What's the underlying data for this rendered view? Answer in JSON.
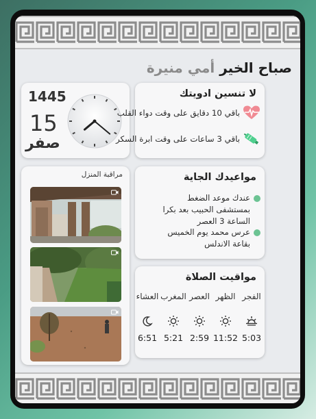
{
  "greeting": {
    "text": "صباح الخير",
    "name": "أمي منيرة"
  },
  "clock": {
    "hijri_year": "1445",
    "hijri_day": "15",
    "hijri_month": "صفر",
    "hour_hand_deg": 230,
    "minute_hand_deg": 130
  },
  "meds": {
    "title": "لا تنسين ادويتك",
    "items": [
      {
        "text": "باقي 10 دقايق على وقت دواء القلب",
        "icon": "heart-pulse-icon"
      },
      {
        "text": "باقي 3 ساعات على وقت ابرة السكر",
        "icon": "insulin-pen-icon"
      }
    ]
  },
  "cameras": {
    "title": "مراقبة المنزل",
    "feeds": [
      "front-porch",
      "backyard-lawn",
      "driveway"
    ]
  },
  "appointments": {
    "title": "مواعيدك الجاية",
    "items": [
      {
        "text": "عندك موعد الضغط بمستشفى الحبيب بعد بكرا الساعة 3 العصر"
      },
      {
        "text": "عرس محمد يوم الخميس بقاعة الاندلس"
      }
    ]
  },
  "prayer": {
    "title": "مواقيت الصلاة",
    "times": [
      {
        "name": "الفجر",
        "time": "5:03",
        "icon": "sunrise-icon"
      },
      {
        "name": "الظهر",
        "time": "11:52",
        "icon": "sun-icon"
      },
      {
        "name": "العصر",
        "time": "2:59",
        "icon": "sun-icon"
      },
      {
        "name": "المغرب",
        "time": "5:21",
        "icon": "sun-icon"
      },
      {
        "name": "العشاء",
        "time": "6:51",
        "icon": "moon-icon"
      }
    ]
  },
  "colors": {
    "dot": "#6cc393",
    "heart": "#e8636f",
    "insulin": "#4fcf8e",
    "title_name": "#8a8a8a"
  }
}
